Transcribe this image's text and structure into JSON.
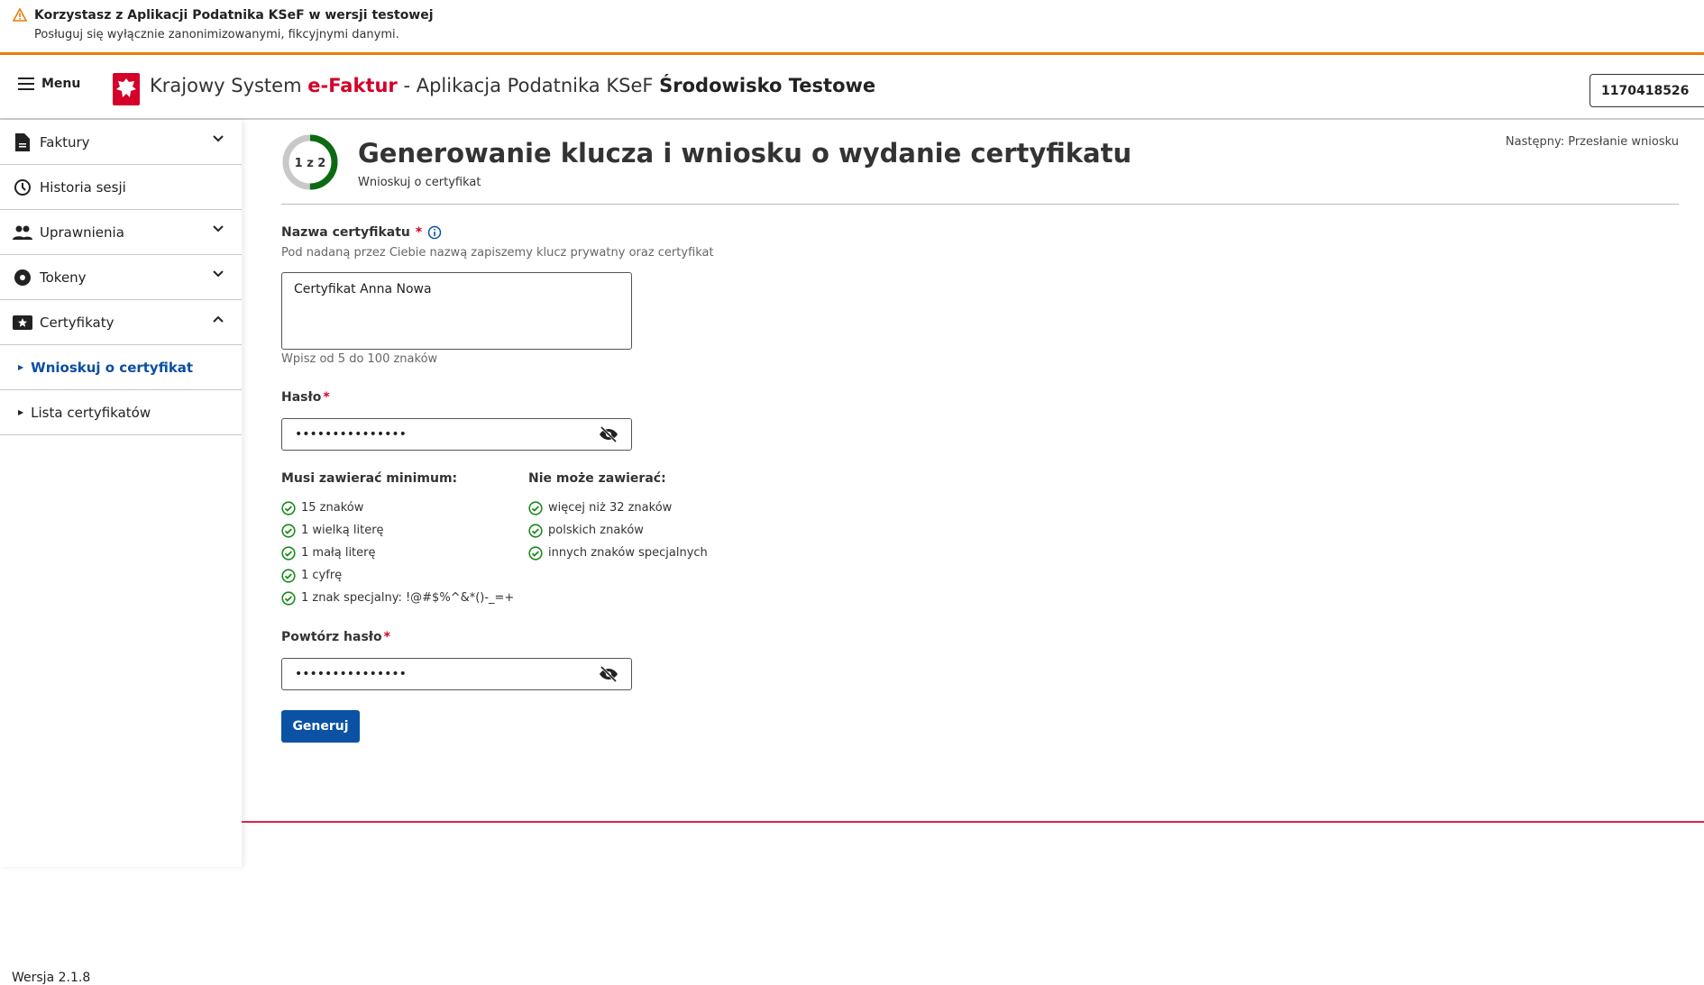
{
  "banner": {
    "title": "Korzystasz z Aplikacji Podatnika KSeF w wersji testowej",
    "subtitle": "Posługuj się wyłącznie zanonimizowanymi, fikcyjnymi danymi."
  },
  "header": {
    "menu_label": "Menu",
    "title_pre": "Krajowy System",
    "title_brand": "e-Faktur",
    "title_mid": " - Aplikacja Podatnika KSeF ",
    "title_env": "Środowisko Testowe",
    "account": "1170418526"
  },
  "sidebar": {
    "items": [
      {
        "label": "Faktury",
        "icon": "file-icon"
      },
      {
        "label": "Historia sesji",
        "icon": "clock-icon"
      },
      {
        "label": "Uprawnienia",
        "icon": "people-icon"
      },
      {
        "label": "Tokeny",
        "icon": "token-icon"
      },
      {
        "label": "Certyfikaty",
        "icon": "certificate-icon"
      }
    ],
    "sub": [
      "Wnioskuj o certyfikat",
      "Lista certyfikatów"
    ],
    "version": "Wersja 2.1.8"
  },
  "main": {
    "step": "1 z 2",
    "step_progress": 0.5,
    "title": "Generowanie klucza i wniosku o wydanie certyfikatu",
    "subtitle": "Wnioskuj o certyfikat",
    "next": "Następny: Przesłanie wniosku",
    "name_label": "Nazwa certyfikatu",
    "name_hint": "Pod nadaną przez Ciebie nazwą zapiszemy klucz prywatny oraz certyfikat",
    "name_value": "Certyfikat Anna Nowa",
    "name_counter": "Wpisz od 5 do 100 znaków",
    "password_label": "Hasło",
    "password_value": "•••••••••••••••",
    "must_title": "Musi zawierać minimum:",
    "must": [
      "15 znaków",
      "1 wielką literę",
      "1 małą literę",
      "1 cyfrę",
      "1 znak specjalny: !@#$%^&*()-_=+"
    ],
    "cannot_title": "Nie może zawierać:",
    "cannot": [
      "więcej niż 32 znaków",
      "polskich znaków",
      "innych znaków specjalnych"
    ],
    "repeat_label": "Powtórz hasło",
    "repeat_value": "•••••••••••••••",
    "required_mark": "*",
    "generate": "Generuj"
  },
  "colors": {
    "accent": "#0b52a5",
    "warning": "#e87d0d",
    "success": "#1a8a1a",
    "required": "#d4002a"
  }
}
